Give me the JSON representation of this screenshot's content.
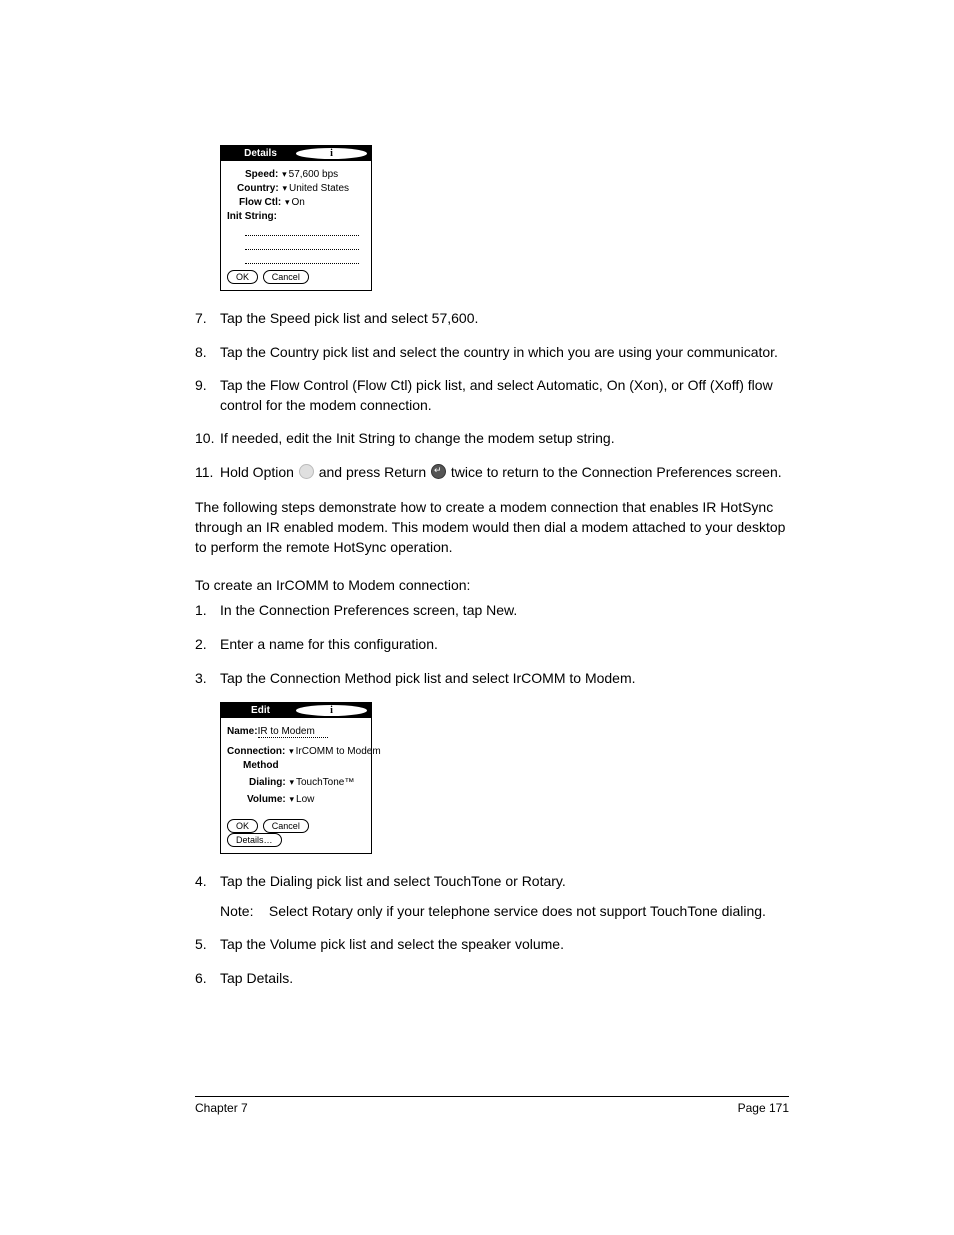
{
  "palm1": {
    "title": "Details",
    "speed_label": "Speed:",
    "speed_value": "57,600 bps",
    "country_label": "Country:",
    "country_value": "United States",
    "flowctl_label": "Flow Ctl:",
    "flowctl_value": "On",
    "init_label": "Init String:",
    "ok": "OK",
    "cancel": "Cancel"
  },
  "steps1": {
    "n7": "7.",
    "t7": "Tap the Speed pick list and select 57,600.",
    "n8": "8.",
    "t8": "Tap the Country pick list and select the country in which you are using your communicator.",
    "n9": "9.",
    "t9": "Tap the Flow Control (Flow Ctl) pick list, and select Automatic, On (Xon), or Off (Xoff) flow control for the modem connection.",
    "n10": "10.",
    "t10": "If needed, edit the Init String to change the modem setup string.",
    "n11": "11.",
    "t11a": "Hold Option ",
    "t11b": " and press Return ",
    "t11c": " twice to return to the Connection Preferences screen."
  },
  "para": "The following steps demonstrate how to create a modem connection that enables IR HotSync through an IR enabled modem. This modem would then dial a modem attached to your desktop to perform the remote HotSync operation.",
  "subhead": "To create an IrCOMM to Modem connection:",
  "steps2": {
    "n1": "1.",
    "t1": "In the Connection Preferences screen, tap New.",
    "n2": "2.",
    "t2": "Enter a name for this configuration.",
    "n3": "3.",
    "t3": "Tap the Connection Method pick list and select IrCOMM to Modem."
  },
  "palm2": {
    "title": "Edit",
    "name_label": "Name:",
    "name_value": "IR to Modem",
    "conn_label": "Connection:",
    "conn_value": "IrCOMM to Modem",
    "method_label": "Method",
    "dialing_label": "Dialing:",
    "dialing_value": "TouchTone™",
    "volume_label": "Volume:",
    "volume_value": "Low",
    "ok": "OK",
    "cancel": "Cancel",
    "details": "Details…"
  },
  "steps3": {
    "n4": "4.",
    "t4": "Tap the Dialing pick list and select TouchTone or Rotary.",
    "note_label": "Note:",
    "note_text": "Select Rotary only if your telephone service does not support TouchTone dialing.",
    "n5": "5.",
    "t5": "Tap the Volume pick list and select the speaker volume.",
    "n6": "6.",
    "t6": "Tap Details."
  },
  "footer": {
    "left": "Chapter 7",
    "right": "Page 171"
  }
}
